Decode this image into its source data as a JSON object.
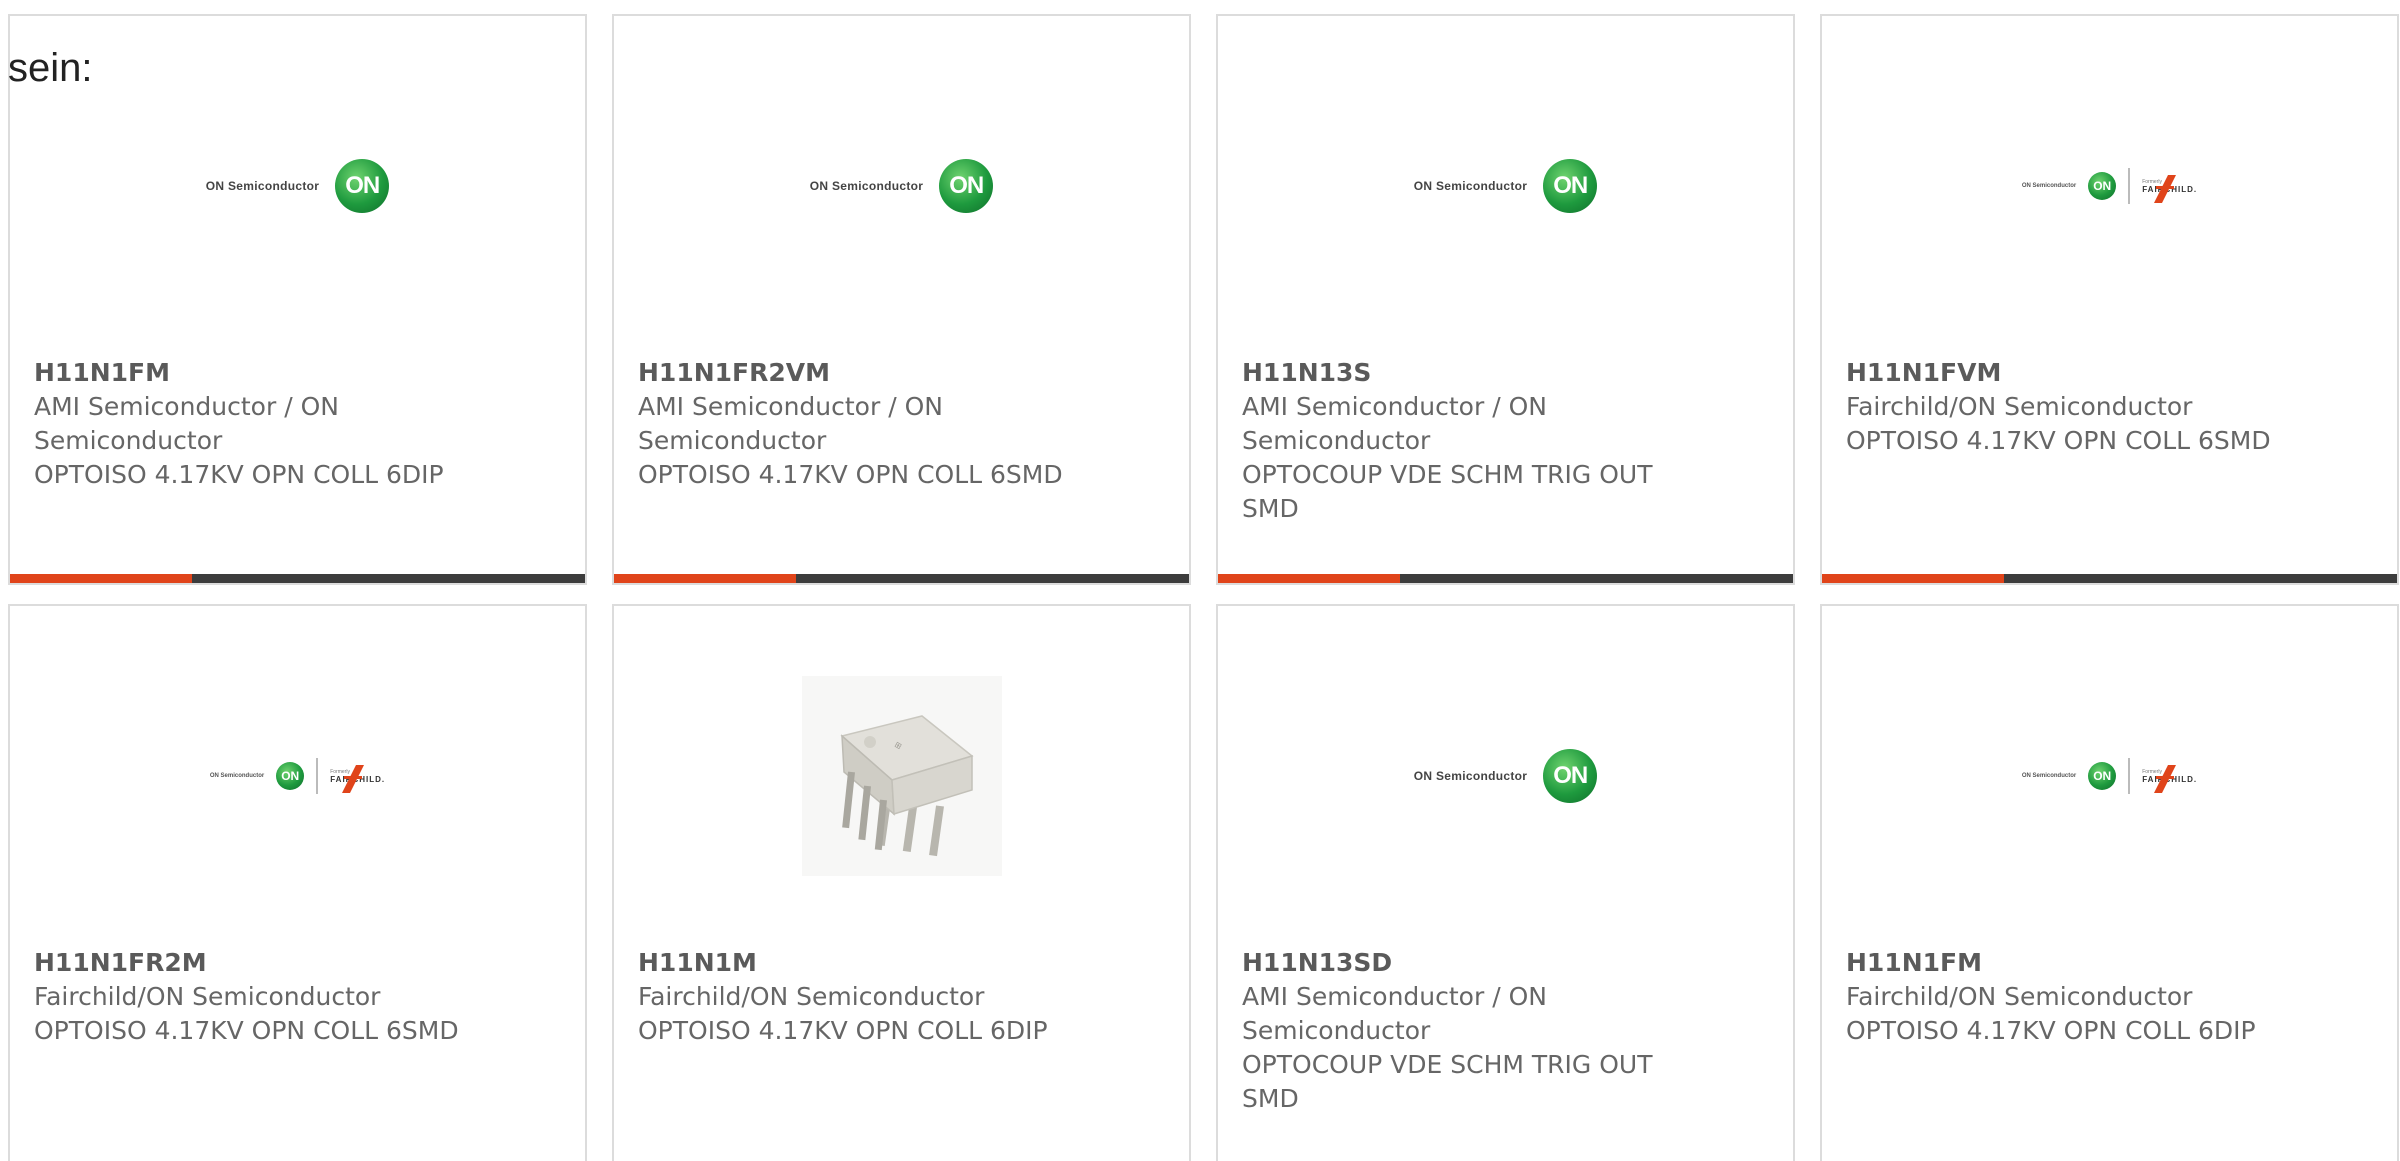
{
  "intro_text": "sein:",
  "colors": {
    "accent_bar": "#e0441a",
    "bar_dark": "#3c3c3c",
    "card_border": "#dcdcdc",
    "text_gray": "#666666"
  },
  "logo_text": {
    "on_wordmark": "ON Semiconductor",
    "on_circle": "ON",
    "formerly": "Formerly",
    "fairchild": "FAIRCHILD."
  },
  "products": [
    {
      "part_number": "H11N1FM",
      "manufacturer": "AMI Semiconductor / ON Semiconductor",
      "description": "OPTOISO 4.17KV OPN COLL 6DIP",
      "image": "on-semiconductor-logo"
    },
    {
      "part_number": "H11N1FR2VM",
      "manufacturer": "AMI Semiconductor / ON Semiconductor",
      "description": "OPTOISO 4.17KV OPN COLL 6SMD",
      "image": "on-semiconductor-logo"
    },
    {
      "part_number": "H11N13S",
      "manufacturer": "AMI Semiconductor / ON Semiconductor",
      "description": "OPTOCOUP VDE SCHM TRIG OUT SMD",
      "image": "on-semiconductor-logo"
    },
    {
      "part_number": "H11N1FVM",
      "manufacturer": "Fairchild/ON Semiconductor",
      "description": "OPTOISO 4.17KV OPN COLL 6SMD",
      "image": "on-fairchild-logo"
    },
    {
      "part_number": "H11N1FR2M",
      "manufacturer": "Fairchild/ON Semiconductor",
      "description": "OPTOISO 4.17KV OPN COLL 6SMD",
      "image": "on-fairchild-logo"
    },
    {
      "part_number": "H11N1M",
      "manufacturer": "Fairchild/ON Semiconductor",
      "description": "OPTOISO 4.17KV OPN COLL 6DIP",
      "image": "dip-chip-photo"
    },
    {
      "part_number": "H11N13SD",
      "manufacturer": "AMI Semiconductor / ON Semiconductor",
      "description": "OPTOCOUP VDE SCHM TRIG OUT SMD",
      "image": "on-semiconductor-logo"
    },
    {
      "part_number": "H11N1FM",
      "manufacturer": "Fairchild/ON Semiconductor",
      "description": "OPTOISO 4.17KV OPN COLL 6DIP",
      "image": "on-fairchild-logo"
    }
  ]
}
